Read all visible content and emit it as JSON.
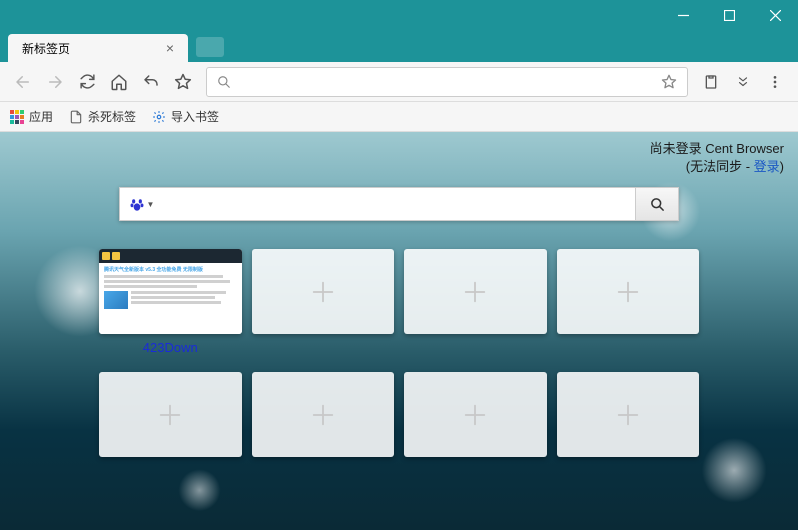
{
  "window": {
    "title": "新标签页"
  },
  "tab": {
    "title": "新标签页"
  },
  "bookmarks": {
    "apps": "应用",
    "kill_tabs": "杀死标签",
    "import": "导入书签"
  },
  "login": {
    "line1": "尚未登录 Cent Browser",
    "line2_prefix": "(无法同步 - ",
    "line2_link": "登录",
    "line2_suffix": ")"
  },
  "search": {
    "placeholder": "",
    "engine": "baidu"
  },
  "tiles": [
    {
      "label": "423Down",
      "empty": false
    },
    {
      "label": "",
      "empty": true
    },
    {
      "label": "",
      "empty": true
    },
    {
      "label": "",
      "empty": true
    },
    {
      "label": "",
      "empty": true
    },
    {
      "label": "",
      "empty": true
    },
    {
      "label": "",
      "empty": true
    },
    {
      "label": "",
      "empty": true
    }
  ]
}
